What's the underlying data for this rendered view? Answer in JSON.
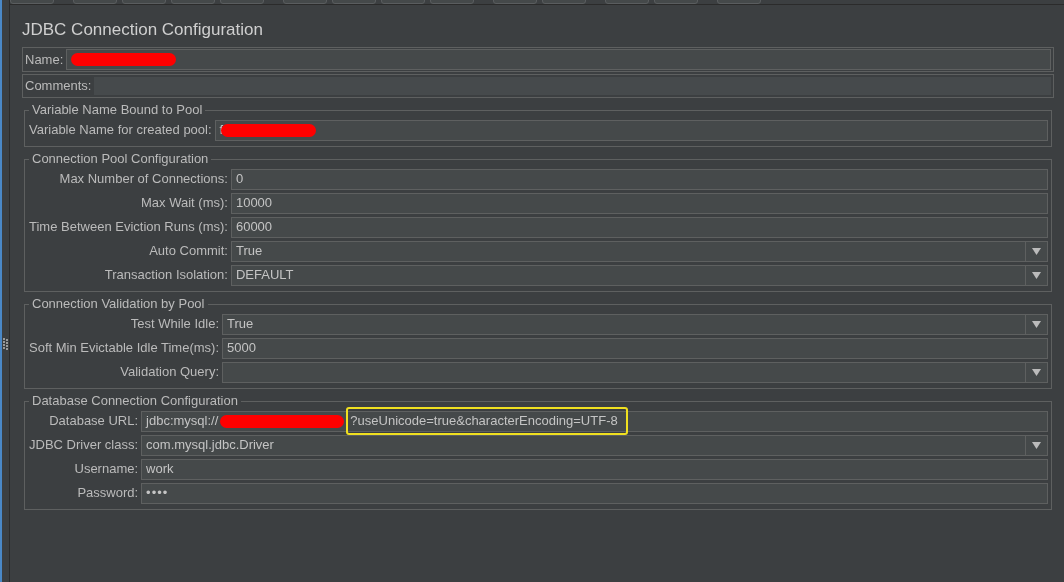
{
  "title": "JDBC Connection Configuration",
  "name": {
    "label": "Name:",
    "redacted": true
  },
  "comments": {
    "label": "Comments:"
  },
  "groups": [
    {
      "title": "Variable Name Bound to Pool",
      "fields": [
        {
          "label": "Variable Name for created pool:",
          "kind": "text",
          "value": "f",
          "redacted": true
        }
      ]
    },
    {
      "title": "Connection Pool Configuration",
      "fields": [
        {
          "label": "Max Number of Connections:",
          "kind": "text",
          "value": "0"
        },
        {
          "label": "Max Wait (ms):",
          "kind": "text",
          "value": "10000"
        },
        {
          "label": "Time Between Eviction Runs (ms):",
          "kind": "text",
          "value": "60000"
        },
        {
          "label": "Auto Commit:",
          "kind": "combo",
          "value": "True"
        },
        {
          "label": "Transaction Isolation:",
          "kind": "combo",
          "value": "DEFAULT"
        }
      ]
    },
    {
      "title": "Connection Validation by Pool",
      "fields": [
        {
          "label": "Test While Idle:",
          "kind": "combo",
          "value": "True"
        },
        {
          "label": "Soft Min Evictable Idle Time(ms):",
          "kind": "text",
          "value": "5000"
        },
        {
          "label": "Validation Query:",
          "kind": "combo"
        }
      ]
    },
    {
      "title": "Database Connection Configuration",
      "fields": [
        {
          "label": "Database URL:",
          "kind": "text",
          "value": "jdbc:mysql://",
          "redacted": true,
          "suffix": "?useUnicode=true&characterEncoding=UTF-8",
          "suffix_highlighted": true
        },
        {
          "label": "JDBC Driver class:",
          "kind": "combo",
          "value": "com.mysql.jdbc.Driver"
        },
        {
          "label": "Username:",
          "kind": "text",
          "value": "work"
        },
        {
          "label": "Password:",
          "kind": "password",
          "value": "••••"
        }
      ]
    }
  ]
}
